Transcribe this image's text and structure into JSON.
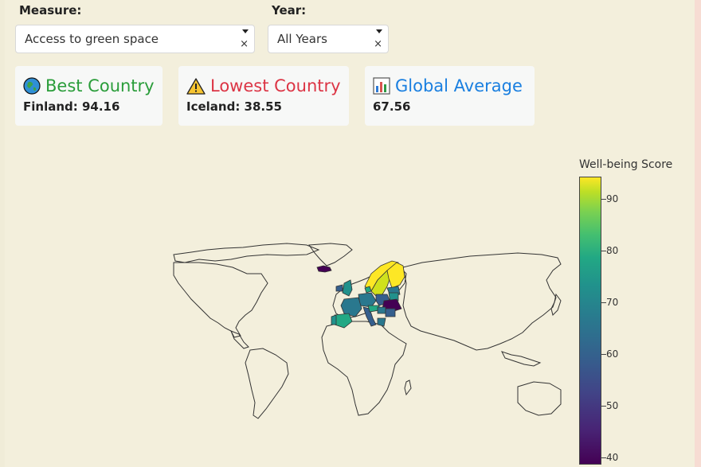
{
  "filters": {
    "measure_label": "Measure:",
    "measure_value": "Access to green space",
    "year_label": "Year:",
    "year_value": "All Years",
    "clear_glyph": "×"
  },
  "cards": {
    "best": {
      "title": "Best Country",
      "value": "Finland: 94.16",
      "color": "#2a9d3a",
      "icon": "globe-icon"
    },
    "lowest": {
      "title": "Lowest Country",
      "value": "Iceland: 38.55",
      "color": "#dc3545",
      "icon": "warning-icon"
    },
    "average": {
      "title": "Global Average",
      "value": "67.56",
      "color": "#1a7fe0",
      "icon": "bar-chart-icon"
    }
  },
  "colorbar": {
    "title": "Well-being Score",
    "ticks": [
      "90",
      "80",
      "70",
      "60",
      "50",
      "40"
    ],
    "colors": {
      "low": "#440154",
      "high": "#fde725"
    }
  }
}
